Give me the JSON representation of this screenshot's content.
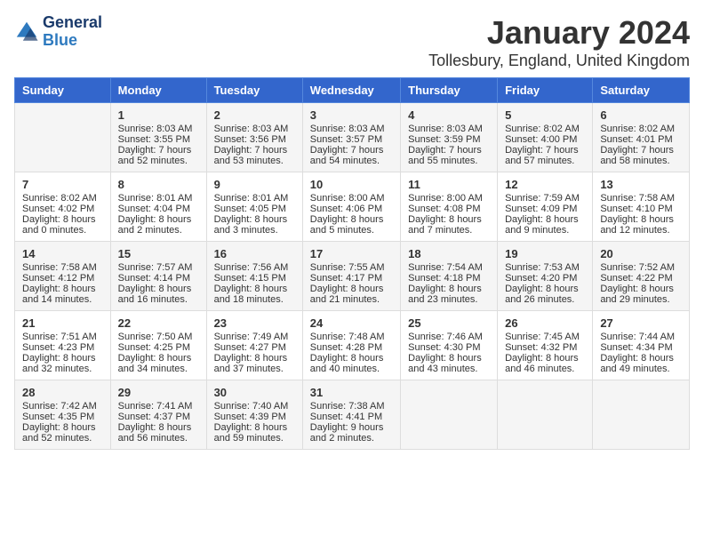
{
  "logo": {
    "line1": "General",
    "line2": "Blue"
  },
  "title": "January 2024",
  "subtitle": "Tollesbury, England, United Kingdom",
  "colors": {
    "header_bg": "#3366cc",
    "odd_row_bg": "#f5f5f5",
    "even_row_bg": "#ffffff"
  },
  "days_of_week": [
    "Sunday",
    "Monday",
    "Tuesday",
    "Wednesday",
    "Thursday",
    "Friday",
    "Saturday"
  ],
  "weeks": [
    [
      {
        "day": "",
        "content": ""
      },
      {
        "day": "1",
        "content": "Sunrise: 8:03 AM\nSunset: 3:55 PM\nDaylight: 7 hours\nand 52 minutes."
      },
      {
        "day": "2",
        "content": "Sunrise: 8:03 AM\nSunset: 3:56 PM\nDaylight: 7 hours\nand 53 minutes."
      },
      {
        "day": "3",
        "content": "Sunrise: 8:03 AM\nSunset: 3:57 PM\nDaylight: 7 hours\nand 54 minutes."
      },
      {
        "day": "4",
        "content": "Sunrise: 8:03 AM\nSunset: 3:59 PM\nDaylight: 7 hours\nand 55 minutes."
      },
      {
        "day": "5",
        "content": "Sunrise: 8:02 AM\nSunset: 4:00 PM\nDaylight: 7 hours\nand 57 minutes."
      },
      {
        "day": "6",
        "content": "Sunrise: 8:02 AM\nSunset: 4:01 PM\nDaylight: 7 hours\nand 58 minutes."
      }
    ],
    [
      {
        "day": "7",
        "content": "Sunrise: 8:02 AM\nSunset: 4:02 PM\nDaylight: 8 hours\nand 0 minutes."
      },
      {
        "day": "8",
        "content": "Sunrise: 8:01 AM\nSunset: 4:04 PM\nDaylight: 8 hours\nand 2 minutes."
      },
      {
        "day": "9",
        "content": "Sunrise: 8:01 AM\nSunset: 4:05 PM\nDaylight: 8 hours\nand 3 minutes."
      },
      {
        "day": "10",
        "content": "Sunrise: 8:00 AM\nSunset: 4:06 PM\nDaylight: 8 hours\nand 5 minutes."
      },
      {
        "day": "11",
        "content": "Sunrise: 8:00 AM\nSunset: 4:08 PM\nDaylight: 8 hours\nand 7 minutes."
      },
      {
        "day": "12",
        "content": "Sunrise: 7:59 AM\nSunset: 4:09 PM\nDaylight: 8 hours\nand 9 minutes."
      },
      {
        "day": "13",
        "content": "Sunrise: 7:58 AM\nSunset: 4:10 PM\nDaylight: 8 hours\nand 12 minutes."
      }
    ],
    [
      {
        "day": "14",
        "content": "Sunrise: 7:58 AM\nSunset: 4:12 PM\nDaylight: 8 hours\nand 14 minutes."
      },
      {
        "day": "15",
        "content": "Sunrise: 7:57 AM\nSunset: 4:14 PM\nDaylight: 8 hours\nand 16 minutes."
      },
      {
        "day": "16",
        "content": "Sunrise: 7:56 AM\nSunset: 4:15 PM\nDaylight: 8 hours\nand 18 minutes."
      },
      {
        "day": "17",
        "content": "Sunrise: 7:55 AM\nSunset: 4:17 PM\nDaylight: 8 hours\nand 21 minutes."
      },
      {
        "day": "18",
        "content": "Sunrise: 7:54 AM\nSunset: 4:18 PM\nDaylight: 8 hours\nand 23 minutes."
      },
      {
        "day": "19",
        "content": "Sunrise: 7:53 AM\nSunset: 4:20 PM\nDaylight: 8 hours\nand 26 minutes."
      },
      {
        "day": "20",
        "content": "Sunrise: 7:52 AM\nSunset: 4:22 PM\nDaylight: 8 hours\nand 29 minutes."
      }
    ],
    [
      {
        "day": "21",
        "content": "Sunrise: 7:51 AM\nSunset: 4:23 PM\nDaylight: 8 hours\nand 32 minutes."
      },
      {
        "day": "22",
        "content": "Sunrise: 7:50 AM\nSunset: 4:25 PM\nDaylight: 8 hours\nand 34 minutes."
      },
      {
        "day": "23",
        "content": "Sunrise: 7:49 AM\nSunset: 4:27 PM\nDaylight: 8 hours\nand 37 minutes."
      },
      {
        "day": "24",
        "content": "Sunrise: 7:48 AM\nSunset: 4:28 PM\nDaylight: 8 hours\nand 40 minutes."
      },
      {
        "day": "25",
        "content": "Sunrise: 7:46 AM\nSunset: 4:30 PM\nDaylight: 8 hours\nand 43 minutes."
      },
      {
        "day": "26",
        "content": "Sunrise: 7:45 AM\nSunset: 4:32 PM\nDaylight: 8 hours\nand 46 minutes."
      },
      {
        "day": "27",
        "content": "Sunrise: 7:44 AM\nSunset: 4:34 PM\nDaylight: 8 hours\nand 49 minutes."
      }
    ],
    [
      {
        "day": "28",
        "content": "Sunrise: 7:42 AM\nSunset: 4:35 PM\nDaylight: 8 hours\nand 52 minutes."
      },
      {
        "day": "29",
        "content": "Sunrise: 7:41 AM\nSunset: 4:37 PM\nDaylight: 8 hours\nand 56 minutes."
      },
      {
        "day": "30",
        "content": "Sunrise: 7:40 AM\nSunset: 4:39 PM\nDaylight: 8 hours\nand 59 minutes."
      },
      {
        "day": "31",
        "content": "Sunrise: 7:38 AM\nSunset: 4:41 PM\nDaylight: 9 hours\nand 2 minutes."
      },
      {
        "day": "",
        "content": ""
      },
      {
        "day": "",
        "content": ""
      },
      {
        "day": "",
        "content": ""
      }
    ]
  ]
}
